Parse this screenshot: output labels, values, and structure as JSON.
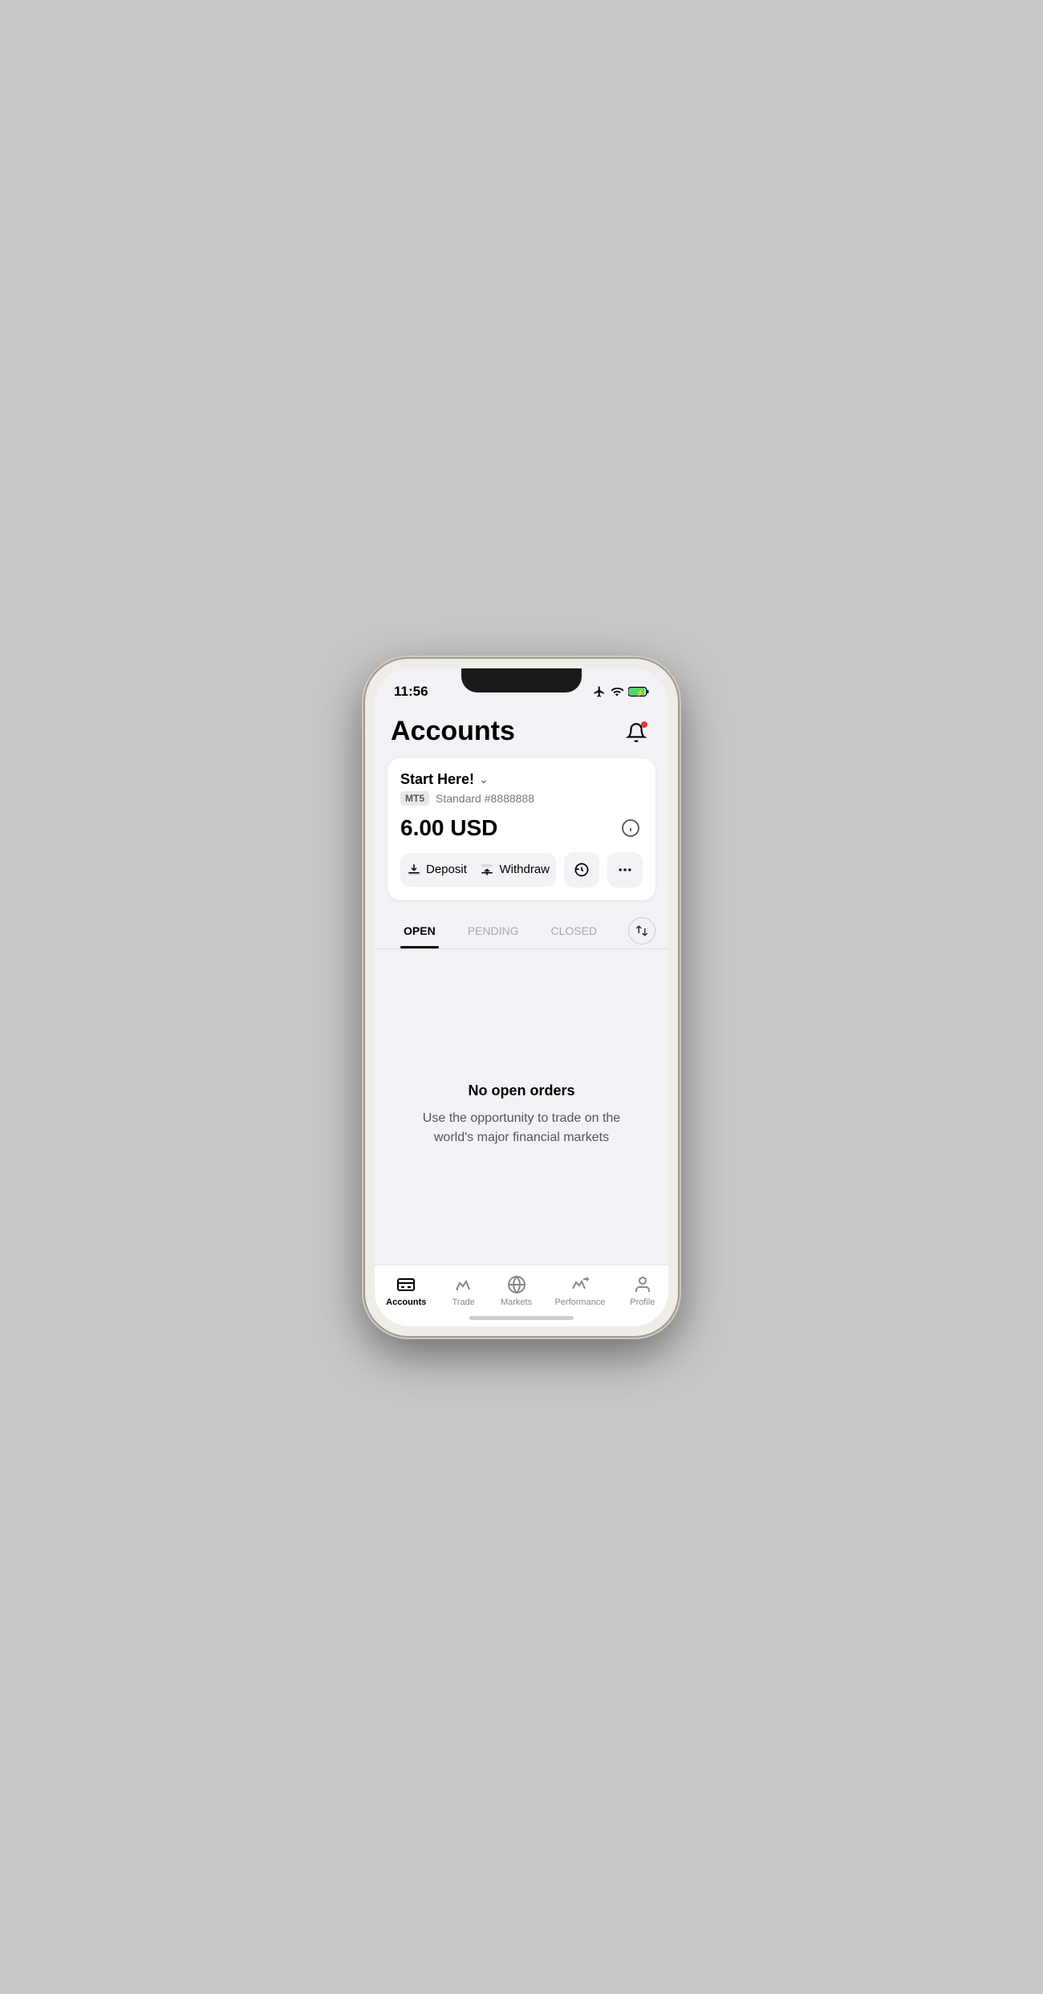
{
  "status_bar": {
    "time": "11:56"
  },
  "header": {
    "title": "Accounts",
    "notification_label": "notifications"
  },
  "account_card": {
    "account_name": "Start Here!",
    "account_type": "MT5",
    "account_number": "Standard #8888888",
    "balance": "6.00 USD",
    "deposit_label": "Deposit",
    "withdraw_label": "Withdraw"
  },
  "tabs": {
    "open_label": "OPEN",
    "pending_label": "PENDING",
    "closed_label": "CLOSED"
  },
  "empty_state": {
    "title": "No open orders",
    "subtitle": "Use the opportunity to trade on the world's major financial markets"
  },
  "bottom_nav": {
    "items": [
      {
        "id": "accounts",
        "label": "Accounts",
        "active": true
      },
      {
        "id": "trade",
        "label": "Trade",
        "active": false
      },
      {
        "id": "markets",
        "label": "Markets",
        "active": false
      },
      {
        "id": "performance",
        "label": "Performance",
        "active": false
      },
      {
        "id": "profile",
        "label": "Profile",
        "active": false
      }
    ]
  }
}
